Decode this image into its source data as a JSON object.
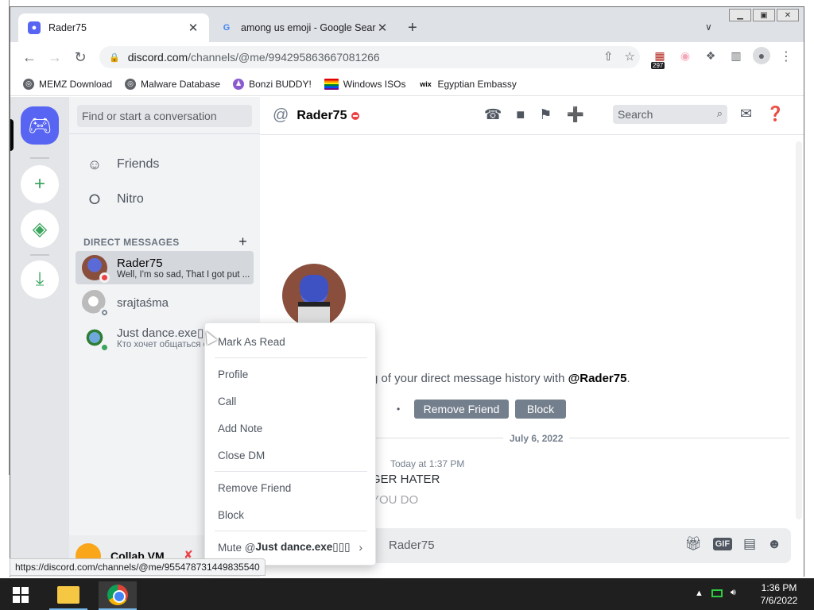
{
  "browser": {
    "tabs": [
      {
        "title": "Rader75",
        "active": true
      },
      {
        "title": "among us emoji - Google Search",
        "active": false
      }
    ],
    "url_host": "discord.com",
    "url_path": "/channels/@me/994295863667081266",
    "extension_badge": "297",
    "bookmarks": [
      "MEMZ Download",
      "Malware Database",
      "Bonzi BUDDY!",
      "Windows ISOs",
      "Egyptian Embassy"
    ],
    "status_url": "https://discord.com/channels/@me/955478731449835540"
  },
  "sidebar": {
    "search_placeholder": "Find or start a conversation",
    "nav": [
      {
        "label": "Friends",
        "icon": "friends-icon"
      },
      {
        "label": "Nitro",
        "icon": "nitro-icon"
      }
    ],
    "dm_header": "DIRECT MESSAGES",
    "dms": [
      {
        "name": "Rader75",
        "subtitle": "Well, I'm so sad, That I got put ...",
        "status": "dnd",
        "status_color": "#ed4245"
      },
      {
        "name": "srajtaśma",
        "subtitle": "",
        "status": "offline",
        "status_color": "#747f8d"
      },
      {
        "name": "Just dance.exe▯▯▯",
        "subtitle": "Кто хочет общаться с",
        "status": "online",
        "status_color": "#3ba55d"
      }
    ],
    "user": {
      "name": "Collab VM"
    }
  },
  "chat": {
    "channel_name": "Rader75",
    "search_placeholder": "Search",
    "intro_prefix": "g of your direct message history with ",
    "intro_user": "@Rader75",
    "intro_suffix": ".",
    "intro_bullet": "•",
    "remove_friend": "Remove Friend",
    "block": "Block",
    "date_divider": "July 6, 2022",
    "message_time": "Today at 1:37 PM",
    "message_line1": "GER HATER",
    "message_line2": "YOU DO",
    "composer_placeholder": "Rader75",
    "gif_label": "GIF"
  },
  "context_menu": {
    "items": [
      "Mark As Read",
      "Profile",
      "Call",
      "Add Note",
      "Close DM",
      "Remove Friend",
      "Block"
    ],
    "mute_prefix": "Mute @",
    "mute_target": "Just dance.exe▯▯▯"
  },
  "taskbar": {
    "time": "1:36 PM",
    "date": "7/6/2022"
  },
  "colors": {
    "discord_blurple": "#5865f2",
    "green": "#3ba55d",
    "red": "#ed4245"
  }
}
